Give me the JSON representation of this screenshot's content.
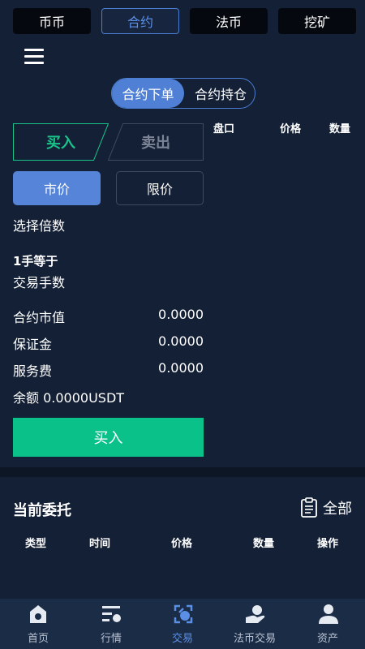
{
  "top_tabs": [
    "币币",
    "合约",
    "法币",
    "挖矿"
  ],
  "segment": {
    "active": "合约下单",
    "inactive": "合约持仓"
  },
  "trade_side": {
    "buy": "买入",
    "sell": "卖出"
  },
  "order_type": {
    "market": "市价",
    "limit": "限价"
  },
  "form": {
    "leverage_label": "选择倍数",
    "lot_equal": "1手等于",
    "lots_label": "交易手数",
    "contract_value_label": "合约市值",
    "contract_value": "0.0000",
    "margin_label": "保证金",
    "margin": "0.0000",
    "fee_label": "服务费",
    "fee": "0.0000",
    "balance": "余额 0.0000USDT",
    "submit_label": "买入"
  },
  "orderbook": {
    "col_depth": "盘口",
    "col_price": "价格",
    "col_qty": "数量"
  },
  "entrust": {
    "title": "当前委托",
    "all_label": "全部",
    "columns": [
      "类型",
      "时间",
      "价格",
      "数量",
      "操作"
    ]
  },
  "bottom_nav": [
    "首页",
    "行情",
    "交易",
    "法币交易",
    "资产"
  ],
  "colors": {
    "accent": "#4f80d6",
    "buy": "#0ac18a",
    "background": "#142036"
  }
}
